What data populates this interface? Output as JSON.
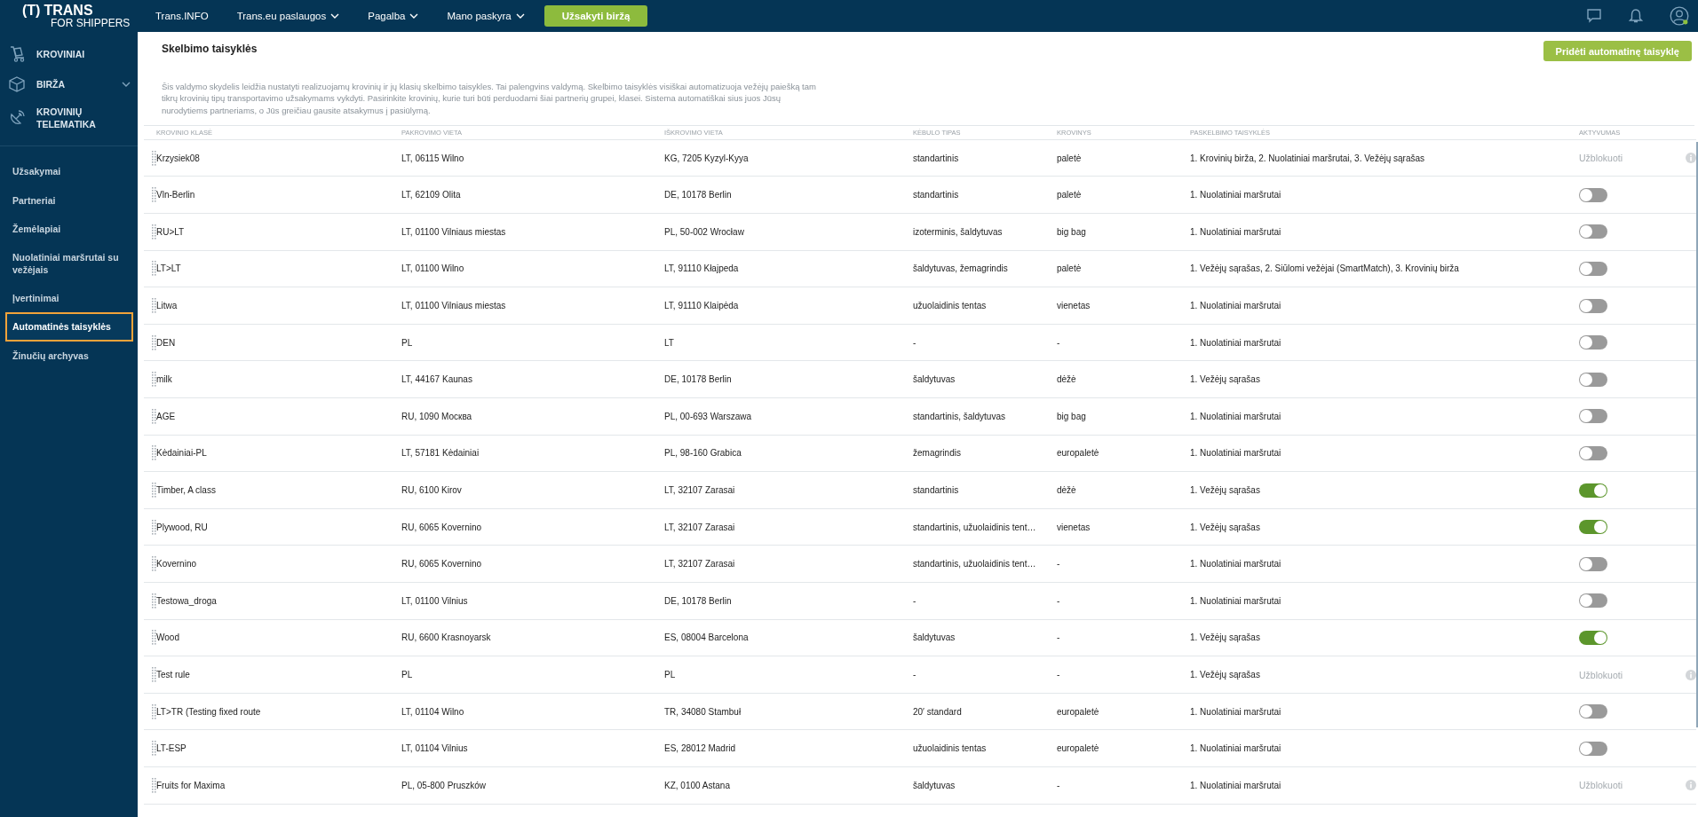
{
  "topbar": {
    "logo": {
      "mark": "(T)",
      "name": "TRANS",
      "tagline": "FOR SHIPPERS"
    },
    "nav": [
      {
        "label": "Trans.INFO",
        "has_menu": false
      },
      {
        "label": "Trans.eu paslaugos",
        "has_menu": true
      },
      {
        "label": "Pagalba",
        "has_menu": true
      },
      {
        "label": "Mano paskyra",
        "has_menu": true
      }
    ],
    "cta": "Užsakyti biržą"
  },
  "sidebar": {
    "modules": [
      {
        "label": "KROVINIAI",
        "has_menu": false
      },
      {
        "label": "BIRŽA",
        "has_menu": true
      },
      {
        "label": "KROVINIŲ TELEMATIKA",
        "has_menu": false
      }
    ],
    "items": [
      {
        "label": "Užsakymai",
        "selected": false
      },
      {
        "label": "Partneriai",
        "selected": false
      },
      {
        "label": "Žemėlapiai",
        "selected": false
      },
      {
        "label": "Nuolatiniai maršrutai su vežėjais",
        "selected": false
      },
      {
        "label": "Įvertinimai",
        "selected": false
      },
      {
        "label": "Automatinės taisyklės",
        "selected": true
      },
      {
        "label": "Žinučių archyvas",
        "selected": false
      }
    ]
  },
  "page": {
    "title": "Skelbimo taisyklės",
    "add_button": "Pridėti automatinę taisyklę",
    "description": "Šis valdymo skydelis leidžia nustatyti realizuojamų krovinių ir jų klasių skelbimo taisykles. Tai palengvins valdymą. Skelbimo taisyklės visiškai automatizuoja vežėjų paiešką tam tikrų krovinių tipų transportavimo užsakymams vykdyti. Pasirinkite krovinių, kurie turi būti perduodami šiai partnerių grupei, klasei. Sistema automatiškai sius juos Jūsų nurodytiems partneriams, o Jūs greičiau gausite atsakymus į pasiūlymą."
  },
  "table": {
    "columns": [
      "KROVINIO KLASĖ",
      "PAKROVIMO VIETA",
      "IŠKROVIMO VIETA",
      "KĖBULO TIPAS",
      "KROVINYS",
      "PASKELBIMO TAISYKLĖS",
      "AKTYVUMAS"
    ],
    "rows": [
      {
        "cells": [
          "Krzysiek08",
          "LT, 06115 Wilno",
          "KG, 7205 Kyzyl-Kyya",
          "standartinis",
          "paletė",
          "1. Krovinių birža, 2. Nuolatiniai maršrutai, 3. Vežėjų sąrašas"
        ],
        "activity": {
          "kind": "blocked",
          "label": "Užblokuoti"
        }
      },
      {
        "cells": [
          "Vln-Berlin",
          "LT, 62109 Olita",
          "DE, 10178 Berlin",
          "standartinis",
          "paletė",
          "1. Nuolatiniai maršrutai"
        ],
        "activity": {
          "kind": "toggle",
          "on": false
        }
      },
      {
        "cells": [
          "RU>LT",
          "LT, 01100 Vilniaus miestas",
          "PL, 50-002 Wrocław",
          "izoterminis, šaldytuvas",
          "big bag",
          "1. Nuolatiniai maršrutai"
        ],
        "activity": {
          "kind": "toggle",
          "on": false
        }
      },
      {
        "cells": [
          "LT>LT",
          "LT, 01100 Wilno",
          "LT, 91110 Kłajpeda",
          "šaldytuvas, žemagrindis",
          "paletė",
          "1. Vežėjų sąrašas, 2. Siūlomi vežėjai (SmartMatch), 3. Krovinių birža"
        ],
        "activity": {
          "kind": "toggle",
          "on": false
        }
      },
      {
        "cells": [
          "Litwa",
          "LT, 01100 Vilniaus miestas",
          "LT, 91110 Klaipėda",
          "užuolaidinis tentas",
          "vienetas",
          "1. Nuolatiniai maršrutai"
        ],
        "activity": {
          "kind": "toggle",
          "on": false
        }
      },
      {
        "cells": [
          "DEN",
          "PL",
          "LT",
          "-",
          "-",
          "1. Nuolatiniai maršrutai"
        ],
        "activity": {
          "kind": "toggle",
          "on": false
        }
      },
      {
        "cells": [
          "milk",
          "LT, 44167 Kaunas",
          "DE, 10178 Berlin",
          "šaldytuvas",
          "dėžė",
          "1. Vežėjų sąrašas"
        ],
        "activity": {
          "kind": "toggle",
          "on": false
        }
      },
      {
        "cells": [
          "AGE",
          "RU, 1090 Москва",
          "PL, 00-693 Warszawa",
          "standartinis, šaldytuvas",
          "big bag",
          "1. Nuolatiniai maršrutai"
        ],
        "activity": {
          "kind": "toggle",
          "on": false
        }
      },
      {
        "cells": [
          "Kėdainiai-PL",
          "LT, 57181 Kėdainiai",
          "PL, 98-160 Grabica",
          "žemagrindis",
          "europaletė",
          "1. Nuolatiniai maršrutai"
        ],
        "activity": {
          "kind": "toggle",
          "on": false
        }
      },
      {
        "cells": [
          "Timber, A class",
          "RU, 6100 Kirov",
          "LT, 32107 Zarasai",
          "standartinis",
          "dėžė",
          "1. Vežėjų sąrašas"
        ],
        "activity": {
          "kind": "toggle",
          "on": true
        }
      },
      {
        "cells": [
          "Plywood, RU",
          "RU, 6065 Kovernino",
          "LT, 32107 Zarasai",
          "standartinis, užuolaidinis tent…",
          "vienetas",
          "1. Vežėjų sąrašas"
        ],
        "activity": {
          "kind": "toggle",
          "on": true
        }
      },
      {
        "cells": [
          "Kovernino",
          "RU, 6065 Kovernino",
          "LT, 32107 Zarasai",
          "standartinis, užuolaidinis tent…",
          "-",
          "1. Nuolatiniai maršrutai"
        ],
        "activity": {
          "kind": "toggle",
          "on": false
        }
      },
      {
        "cells": [
          "Testowa_droga",
          "LT, 01100 Vilnius",
          "DE, 10178 Berlin",
          "-",
          "-",
          "1. Nuolatiniai maršrutai"
        ],
        "activity": {
          "kind": "toggle",
          "on": false
        }
      },
      {
        "cells": [
          "Wood",
          "RU, 6600 Krasnoyarsk",
          "ES, 08004 Barcelona",
          "šaldytuvas",
          "-",
          "1. Vežėjų sąrašas"
        ],
        "activity": {
          "kind": "toggle",
          "on": true
        }
      },
      {
        "cells": [
          "Test rule",
          "PL",
          "PL",
          "-",
          "-",
          "1. Vežėjų sąrašas"
        ],
        "activity": {
          "kind": "blocked",
          "label": "Užblokuoti"
        }
      },
      {
        "cells": [
          "LT>TR (Testing fixed route",
          "LT, 01104 Wilno",
          "TR, 34080 Stambuł",
          "20′ standard",
          "europaletė",
          "1. Nuolatiniai maršrutai"
        ],
        "activity": {
          "kind": "toggle",
          "on": false
        }
      },
      {
        "cells": [
          "LT-ESP",
          "LT, 01104 Vilnius",
          "ES, 28012 Madrid",
          "užuolaidinis tentas",
          "europaletė",
          "1. Nuolatiniai maršrutai"
        ],
        "activity": {
          "kind": "toggle",
          "on": false
        }
      },
      {
        "cells": [
          "Fruits for Maxima",
          "PL, 05-800 Pruszków",
          "KZ, 0100 Astana",
          "šaldytuvas",
          "-",
          "1. Nuolatiniai maršrutai"
        ],
        "activity": {
          "kind": "blocked",
          "label": "Užblokuoti"
        }
      }
    ]
  }
}
